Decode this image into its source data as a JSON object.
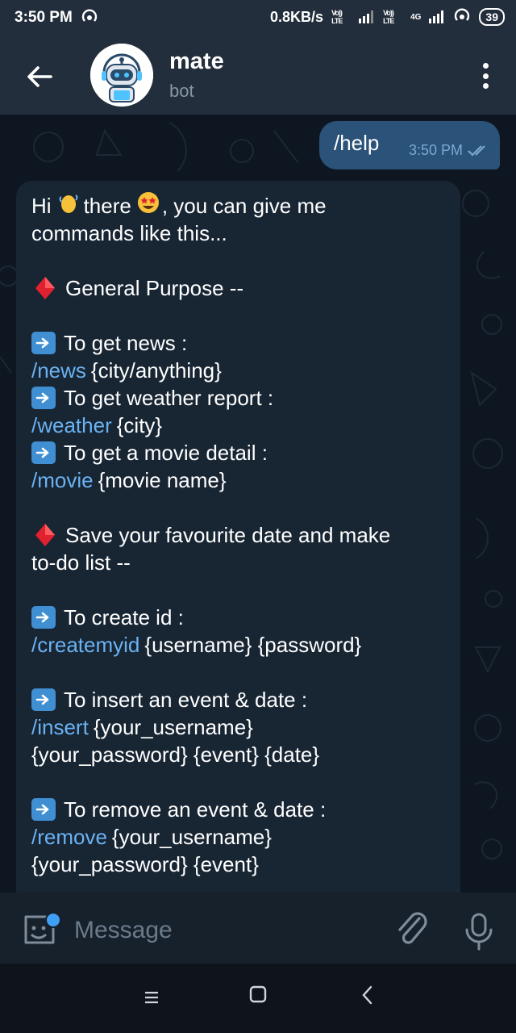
{
  "status_bar": {
    "time": "3:50 PM",
    "speed": "0.8KB/s",
    "sim1": "Vo)) LTE",
    "sim2": "Vo)) LTE",
    "network": "4G",
    "battery": "39"
  },
  "header": {
    "name": "mate",
    "status": "bot"
  },
  "outgoing": {
    "text": "/help",
    "time": "3:50 PM"
  },
  "incoming": {
    "lines": [
      {
        "kind": "greet",
        "a": "Hi",
        "b": "there",
        "c": ", you can give me"
      },
      {
        "kind": "text",
        "text": "commands like this..."
      },
      {
        "kind": "blank"
      },
      {
        "kind": "diamond",
        "text": "General Purpose --"
      },
      {
        "kind": "blank"
      },
      {
        "kind": "arrow",
        "text": "To get news :"
      },
      {
        "kind": "cmd",
        "cmd": "/news",
        "args": "{city/anything}"
      },
      {
        "kind": "arrow",
        "text": "To get weather report :"
      },
      {
        "kind": "cmd",
        "cmd": "/weather",
        "args": "{city}"
      },
      {
        "kind": "arrow",
        "text": "To get a movie detail :"
      },
      {
        "kind": "cmd",
        "cmd": "/movie",
        "args": "{movie name}"
      },
      {
        "kind": "blank"
      },
      {
        "kind": "diamond",
        "text": "Save your favourite date and make"
      },
      {
        "kind": "text",
        "text": "to-do list --"
      },
      {
        "kind": "blank"
      },
      {
        "kind": "arrow",
        "text": "To create id :"
      },
      {
        "kind": "cmd",
        "cmd": "/createmyid",
        "args": "{username} {password}"
      },
      {
        "kind": "blank"
      },
      {
        "kind": "arrow",
        "text": "To insert an event & date :"
      },
      {
        "kind": "cmd",
        "cmd": "/insert",
        "args": "{your_username}"
      },
      {
        "kind": "text",
        "text": "{your_password} {event} {date}"
      },
      {
        "kind": "blank"
      },
      {
        "kind": "arrow",
        "text": "To remove an event & date :"
      },
      {
        "kind": "cmd",
        "cmd": "/remove",
        "args": "{your_username}"
      },
      {
        "kind": "text",
        "text": "{your_password} {event}"
      }
    ]
  },
  "input": {
    "placeholder": "Message"
  },
  "icons": {
    "back": "arrow-left-icon",
    "menu": "more-vertical-icon",
    "emoji": "sticker-emoji-icon",
    "attach": "paperclip-icon",
    "mic": "microphone-icon",
    "read": "double-check-icon"
  },
  "colors": {
    "chat_bg": "#0e1621",
    "header_bg": "#232e3c",
    "out_bubble": "#2b5278",
    "in_bubble": "#182533",
    "link": "#6ab2f2",
    "muted": "#8796a5"
  }
}
